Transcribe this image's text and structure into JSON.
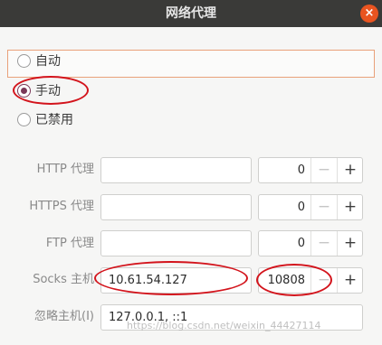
{
  "window": {
    "title": "网络代理",
    "close_glyph": "×"
  },
  "method": {
    "options": [
      {
        "label": "自动",
        "selected": false
      },
      {
        "label": "手动",
        "selected": true
      },
      {
        "label": "已禁用",
        "selected": false
      }
    ]
  },
  "proxies": [
    {
      "label": "HTTP 代理",
      "host": "",
      "port": "0"
    },
    {
      "label": "HTTPS 代理",
      "host": "",
      "port": "0"
    },
    {
      "label": "FTP 代理",
      "host": "",
      "port": "0"
    },
    {
      "label": "Socks 主机",
      "host": "10.61.54.127",
      "port": "10808"
    }
  ],
  "ignore": {
    "label": "忽略主机(I)",
    "value": "127.0.0.1, ::1"
  },
  "spin": {
    "minus": "−",
    "plus": "+"
  },
  "watermark": "https://blog.csdn.net/weixin_44427114",
  "colors": {
    "accent": "#e95420",
    "radio_checked": "#7a3858",
    "annotation": "#d3141c"
  }
}
